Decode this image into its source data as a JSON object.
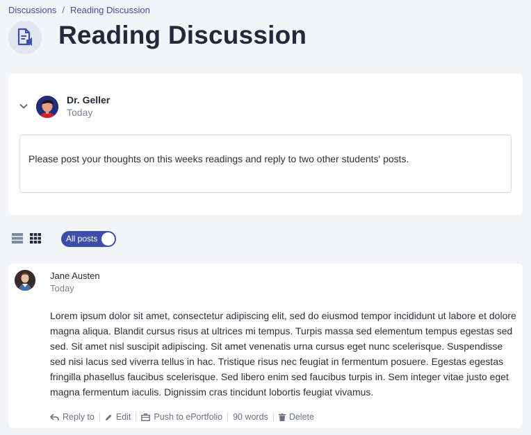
{
  "breadcrumb": {
    "parent": "Discussions",
    "separator": "/",
    "current": "Reading Discussion"
  },
  "page": {
    "title": "Reading Discussion",
    "icon": "document-audio-icon"
  },
  "topic": {
    "author": "Dr. Geller",
    "date": "Today",
    "prompt": "Please post your thoughts on this weeks readings and reply to two other students' posts."
  },
  "controls": {
    "list_view_icon": "list-view-icon",
    "grid_view_icon": "grid-view-icon",
    "toggle_label": "All posts",
    "toggle_on": true
  },
  "post": {
    "author": "Jane Austen",
    "date": "Today",
    "body": "Lorem ipsum dolor sit amet, consectetur adipiscing elit, sed do eiusmod tempor incididunt ut labore et dolore magna aliqua. Blandit cursus risus at ultrices mi tempus. Turpis massa sed elementum tempus egestas sed sed. Sit amet nisl suscipit adipiscing. Sit amet venenatis urna cursus eget nunc scelerisque. Suspendisse sed nisi lacus sed viverra tellus in hac. Tristique risus nec feugiat in fermentum posuere. Egestas egestas fringilla phasellus faucibus scelerisque. Sed libero enim sed faucibus turpis in. Sem integer vitae justo eget magna fermentum iaculis. Dignissim cras tincidunt lobortis feugiat vivamus.",
    "actions": {
      "reply": "Reply to",
      "edit": "Edit",
      "push": "Push to ePortfolio",
      "words": "90 words",
      "delete": "Delete"
    }
  },
  "colors": {
    "accent": "#3d4ea8",
    "background": "#f3f4f8",
    "card": "#ffffff"
  }
}
